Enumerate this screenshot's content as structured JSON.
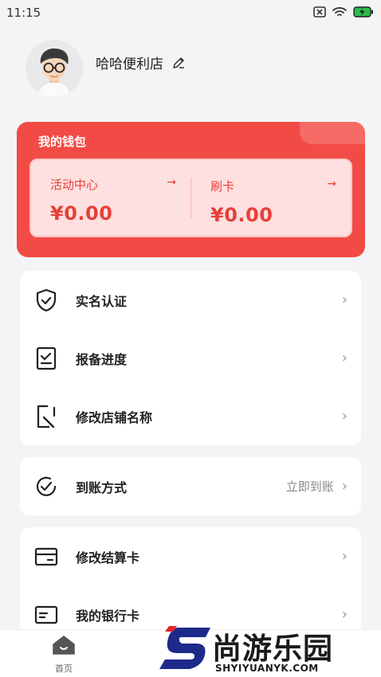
{
  "status_bar": {
    "time": "11:15"
  },
  "profile": {
    "store_name": "哈哈便利店"
  },
  "wallet": {
    "title": "我的钱包",
    "items": [
      {
        "label": "活动中心",
        "amount": "¥0.00"
      },
      {
        "label": "刷卡",
        "amount": "¥0.00"
      }
    ]
  },
  "menu_group_1": [
    {
      "label": "实名认证",
      "icon": "shield-check-icon"
    },
    {
      "label": "报备进度",
      "icon": "clipboard-check-icon"
    },
    {
      "label": "修改店铺名称",
      "icon": "edit-document-icon"
    }
  ],
  "menu_group_2": [
    {
      "label": "到账方式",
      "value": "立即到账",
      "icon": "clock-check-icon"
    }
  ],
  "menu_group_3": [
    {
      "label": "修改结算卡",
      "icon": "card-icon"
    },
    {
      "label": "我的银行卡",
      "icon": "bank-card-icon"
    }
  ],
  "tab_bar": {
    "home_label": "首页"
  },
  "watermark": {
    "name": "尚游乐园",
    "url": "SHYIYUANYK.COM"
  },
  "colors": {
    "accent": "#f24b45",
    "wallet_inner": "#fde0df"
  }
}
